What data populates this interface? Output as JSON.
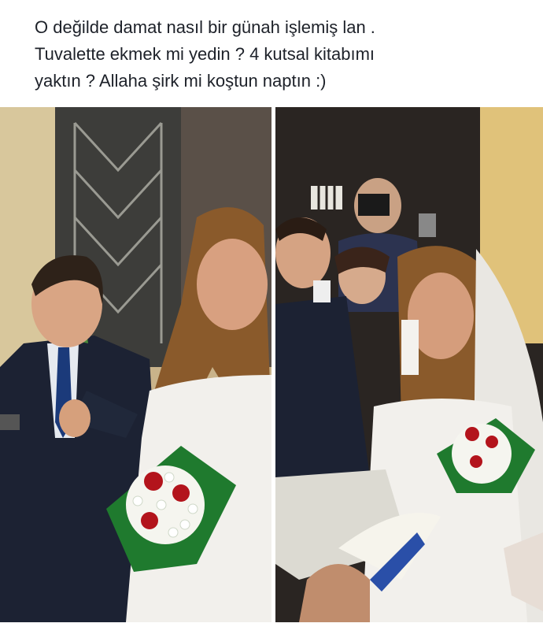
{
  "post": {
    "text": "O değilde damat nasıl bir günah işlemiş lan .\nTuvalette ekmek mi yedin ? 4 kutsal kitabımı\nyaktın ? Allaha şirk mi koştun naptın :)"
  },
  "image": {
    "left_photo": "wedding-couple-walking-photo",
    "right_photo": "bride-drinking-toast-photo"
  },
  "colors": {
    "text": "#1d2129",
    "suit": "#1c2233",
    "dress": "#f2f0ec",
    "bouquet_green": "#1f7a2e",
    "rose_red": "#b3141c"
  }
}
